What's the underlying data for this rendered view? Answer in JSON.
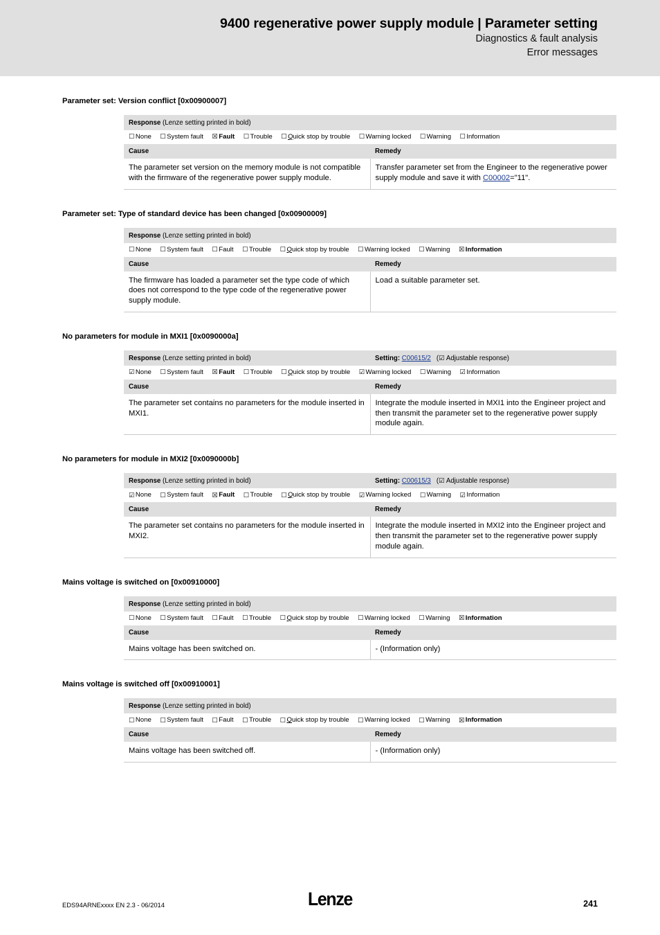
{
  "header": {
    "title": "9400 regenerative power supply module | Parameter setting",
    "subtitle1": "Diagnostics & fault analysis",
    "subtitle2": "Error messages"
  },
  "labels": {
    "response_label": "Response",
    "response_note": "(Lenze setting printed in bold)",
    "setting_label": "Setting:",
    "adjustable_note": "(☑ Adjustable response)",
    "cause_header": "Cause",
    "remedy_header": "Remedy"
  },
  "checkbox_glyphs": {
    "empty": "☐",
    "checked": "☑",
    "crossed": "☒"
  },
  "sections": [
    {
      "heading": "Parameter set: Version conflict [0x00900007]",
      "setting": null,
      "responses": [
        {
          "label": "None",
          "state": "empty",
          "bold": false
        },
        {
          "label": "System fault",
          "state": "empty",
          "bold": false
        },
        {
          "label": "Fault",
          "state": "crossed",
          "bold": true
        },
        {
          "label": "Trouble",
          "state": "empty",
          "bold": false
        },
        {
          "label": "Quick stop by trouble",
          "state": "empty",
          "bold": false,
          "accel": "Q"
        },
        {
          "label": "Warning locked",
          "state": "empty",
          "bold": false
        },
        {
          "label": "Warning",
          "state": "empty",
          "bold": false
        },
        {
          "label": "Information",
          "state": "empty",
          "bold": false
        }
      ],
      "cause": "The parameter set version on the memory module is not compatible with the firmware of the regenerative power supply module.",
      "remedy_pre": "Transfer parameter set from the Engineer to the regenerative power supply module and save it with ",
      "remedy_link": "C00002",
      "remedy_post": "=\"11\"."
    },
    {
      "heading": "Parameter set: Type of standard device has been changed [0x00900009]",
      "setting": null,
      "responses": [
        {
          "label": "None",
          "state": "empty",
          "bold": false
        },
        {
          "label": "System fault",
          "state": "empty",
          "bold": false
        },
        {
          "label": "Fault",
          "state": "empty",
          "bold": false
        },
        {
          "label": "Trouble",
          "state": "empty",
          "bold": false
        },
        {
          "label": "Quick stop by trouble",
          "state": "empty",
          "bold": false,
          "accel": "Q"
        },
        {
          "label": "Warning locked",
          "state": "empty",
          "bold": false
        },
        {
          "label": "Warning",
          "state": "empty",
          "bold": false
        },
        {
          "label": "Information",
          "state": "crossed",
          "bold": true
        }
      ],
      "cause": "The firmware has loaded a parameter set the type code of which does not correspond to the type code of the regenerative power supply module.",
      "remedy_pre": "Load a suitable parameter set.",
      "remedy_link": null,
      "remedy_post": ""
    },
    {
      "heading": "No parameters for module in MXI1 [0x0090000a]",
      "setting": "C00615/2",
      "responses": [
        {
          "label": "None",
          "state": "checked",
          "bold": false
        },
        {
          "label": "System fault",
          "state": "empty",
          "bold": false
        },
        {
          "label": "Fault",
          "state": "crossed",
          "bold": true
        },
        {
          "label": "Trouble",
          "state": "empty",
          "bold": false
        },
        {
          "label": "Quick stop by trouble",
          "state": "empty",
          "bold": false,
          "accel": "Q"
        },
        {
          "label": "Warning locked",
          "state": "checked",
          "bold": false
        },
        {
          "label": "Warning",
          "state": "empty",
          "bold": false
        },
        {
          "label": "Information",
          "state": "checked",
          "bold": false
        }
      ],
      "cause": "The parameter set contains no parameters for the module inserted in MXI1.",
      "remedy_pre": "Integrate the module inserted in MXI1 into the Engineer project and then transmit the parameter set to the regenerative power supply module again.",
      "remedy_link": null,
      "remedy_post": ""
    },
    {
      "heading": "No parameters for module in MXI2 [0x0090000b]",
      "setting": "C00615/3",
      "responses": [
        {
          "label": "None",
          "state": "checked",
          "bold": false
        },
        {
          "label": "System fault",
          "state": "empty",
          "bold": false
        },
        {
          "label": "Fault",
          "state": "crossed",
          "bold": true
        },
        {
          "label": "Trouble",
          "state": "empty",
          "bold": false
        },
        {
          "label": "Quick stop by trouble",
          "state": "empty",
          "bold": false,
          "accel": "Q"
        },
        {
          "label": "Warning locked",
          "state": "checked",
          "bold": false
        },
        {
          "label": "Warning",
          "state": "empty",
          "bold": false
        },
        {
          "label": "Information",
          "state": "checked",
          "bold": false
        }
      ],
      "cause": "The parameter set contains no parameters for the module inserted in MXI2.",
      "remedy_pre": "Integrate the module inserted in MXI2 into the Engineer project and then transmit the parameter set to the regenerative power supply module again.",
      "remedy_link": null,
      "remedy_post": ""
    },
    {
      "heading": "Mains voltage is switched on [0x00910000]",
      "setting": null,
      "responses": [
        {
          "label": "None",
          "state": "empty",
          "bold": false
        },
        {
          "label": "System fault",
          "state": "empty",
          "bold": false
        },
        {
          "label": "Fault",
          "state": "empty",
          "bold": false
        },
        {
          "label": "Trouble",
          "state": "empty",
          "bold": false
        },
        {
          "label": "Quick stop by trouble",
          "state": "empty",
          "bold": false,
          "accel": "Q"
        },
        {
          "label": "Warning locked",
          "state": "empty",
          "bold": false
        },
        {
          "label": "Warning",
          "state": "empty",
          "bold": false
        },
        {
          "label": "Information",
          "state": "crossed",
          "bold": true
        }
      ],
      "cause": "Mains voltage has been switched on.",
      "remedy_pre": "- (Information only)",
      "remedy_link": null,
      "remedy_post": ""
    },
    {
      "heading": "Mains voltage is switched off [0x00910001]",
      "setting": null,
      "responses": [
        {
          "label": "None",
          "state": "empty",
          "bold": false
        },
        {
          "label": "System fault",
          "state": "empty",
          "bold": false
        },
        {
          "label": "Fault",
          "state": "empty",
          "bold": false
        },
        {
          "label": "Trouble",
          "state": "empty",
          "bold": false
        },
        {
          "label": "Quick stop by trouble",
          "state": "empty",
          "bold": false,
          "accel": "Q"
        },
        {
          "label": "Warning locked",
          "state": "empty",
          "bold": false
        },
        {
          "label": "Warning",
          "state": "empty",
          "bold": false
        },
        {
          "label": "Information",
          "state": "crossed",
          "bold": true
        }
      ],
      "cause": "Mains voltage has been switched off.",
      "remedy_pre": "- (Information only)",
      "remedy_link": null,
      "remedy_post": ""
    }
  ],
  "footer": {
    "doc_id": "EDS94ARNExxxx EN 2.3 - 06/2014",
    "logo": "Lenze",
    "page_number": "241"
  }
}
